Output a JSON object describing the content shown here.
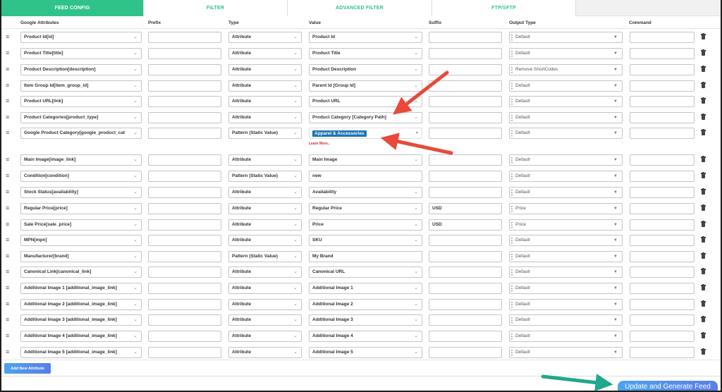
{
  "tabs": [
    {
      "label": "FEED CONFIG",
      "active": true
    },
    {
      "label": "FILTER",
      "active": false
    },
    {
      "label": "ADVANCED FILTER",
      "active": false
    },
    {
      "label": "FTP/SFTP",
      "active": false
    }
  ],
  "columns": {
    "google_attributes": "Google Attributes",
    "prefix": "Prefix",
    "type": "Type",
    "value": "Value",
    "suffix": "Suffix",
    "output_type": "Output Type",
    "command": "Command"
  },
  "rows": [
    {
      "attribute": "Product Id[id]",
      "prefix": "",
      "type": "Attribute",
      "value": "Product Id",
      "value_kind": "select",
      "suffix": "",
      "output_type": "Default",
      "command": ""
    },
    {
      "attribute": "Product Title[title]",
      "prefix": "",
      "type": "Attribute",
      "value": "Product Title",
      "value_kind": "select",
      "suffix": "",
      "output_type": "Default",
      "command": ""
    },
    {
      "attribute": "Product Description[description]",
      "prefix": "",
      "type": "Attribute",
      "value": "Product Description",
      "value_kind": "select",
      "suffix": "",
      "output_type": "Remove ShortCodes",
      "command": ""
    },
    {
      "attribute": "Item Group Id[item_group_id]",
      "prefix": "",
      "type": "Attribute",
      "value": "Parent Id [Group Id]",
      "value_kind": "select",
      "suffix": "",
      "output_type": "Default",
      "command": ""
    },
    {
      "attribute": "Product URL[link]",
      "prefix": "",
      "type": "Attribute",
      "value": "Product URL",
      "value_kind": "select",
      "suffix": "",
      "output_type": "Default",
      "command": ""
    },
    {
      "attribute": "Product Categories[product_type]",
      "prefix": "",
      "type": "Attribute",
      "value": "Product Category [Category Path]",
      "value_kind": "select",
      "suffix": "",
      "output_type": "Default",
      "command": ""
    },
    {
      "attribute": "Google Product Category[google_product_cat",
      "prefix": "",
      "type": "Pattern (Static Value)",
      "value": "Apparel & Accessories",
      "value_kind": "category",
      "suffix": "",
      "output_type": "Default",
      "command": "",
      "learn_more": "Learn More.."
    },
    {
      "attribute": "Main Image[image_link]",
      "prefix": "",
      "type": "Attribute",
      "value": "Main Image",
      "value_kind": "select",
      "suffix": "",
      "output_type": "Default",
      "command": ""
    },
    {
      "attribute": "Condition[condition]",
      "prefix": "",
      "type": "Pattern (Static Value)",
      "value": "new",
      "value_kind": "text",
      "suffix": "",
      "output_type": "Default",
      "command": ""
    },
    {
      "attribute": "Stock Status[availability]",
      "prefix": "",
      "type": "Attribute",
      "value": "Availability",
      "value_kind": "select",
      "suffix": "",
      "output_type": "Default",
      "command": ""
    },
    {
      "attribute": "Regular Price[price]",
      "prefix": "",
      "type": "Attribute",
      "value": "Regular Price",
      "value_kind": "select",
      "suffix": "USD",
      "output_type": "Price",
      "command": ""
    },
    {
      "attribute": "Sale Price[sale_price]",
      "prefix": "",
      "type": "Attribute",
      "value": "Price",
      "value_kind": "select",
      "suffix": "USD",
      "output_type": "Price",
      "command": ""
    },
    {
      "attribute": "MPN[mpn]",
      "prefix": "",
      "type": "Attribute",
      "value": "SKU",
      "value_kind": "select",
      "suffix": "",
      "output_type": "Default",
      "command": ""
    },
    {
      "attribute": "Manufacturer[brand]",
      "prefix": "",
      "type": "Pattern (Static Value)",
      "value": "My Brand",
      "value_kind": "text",
      "suffix": "",
      "output_type": "Default",
      "command": ""
    },
    {
      "attribute": "Canonical Link[canonical_link]",
      "prefix": "",
      "type": "Attribute",
      "value": "Canonical URL",
      "value_kind": "select",
      "suffix": "",
      "output_type": "Default",
      "command": ""
    },
    {
      "attribute": "Additional Image 1 [additional_image_link]",
      "prefix": "",
      "type": "Attribute",
      "value": "Additional Image 1",
      "value_kind": "select",
      "suffix": "",
      "output_type": "Default",
      "command": ""
    },
    {
      "attribute": "Additional Image 2 [additional_image_link]",
      "prefix": "",
      "type": "Attribute",
      "value": "Additional Image 2",
      "value_kind": "select",
      "suffix": "",
      "output_type": "Default",
      "command": ""
    },
    {
      "attribute": "Additional Image 3 [additional_image_link]",
      "prefix": "",
      "type": "Attribute",
      "value": "Additional Image 3",
      "value_kind": "select",
      "suffix": "",
      "output_type": "Default",
      "command": ""
    },
    {
      "attribute": "Additional Image 4 [additional_image_link]",
      "prefix": "",
      "type": "Attribute",
      "value": "Additional Image 4",
      "value_kind": "select",
      "suffix": "",
      "output_type": "Default",
      "command": ""
    },
    {
      "attribute": "Additional Image 5 [additional_image_link]",
      "prefix": "",
      "type": "Attribute",
      "value": "Additional Image 5",
      "value_kind": "select",
      "suffix": "",
      "output_type": "Default",
      "command": ""
    }
  ],
  "buttons": {
    "add_attribute": "Add New Attribute",
    "update_generate": "Update and Generate Feed"
  },
  "icons": {
    "drag": "drag-handle-icon",
    "delete": "trash-icon",
    "select": "chevron-down-icon"
  },
  "colors": {
    "accent": "#2fc38a",
    "button": "#4a90e2",
    "annotation_red": "#e8493a",
    "annotation_teal": "#1fa88a",
    "category_pill": "#1b74b6"
  }
}
